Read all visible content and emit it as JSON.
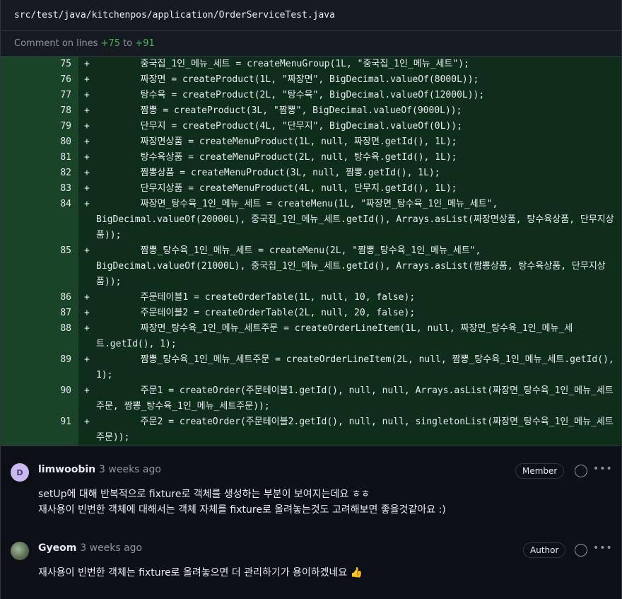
{
  "file": {
    "path": "src/test/java/kitchenpos/application/OrderServiceTest.java"
  },
  "comment_lines": {
    "prefix": "Comment on lines",
    "start": "+75",
    "sep": "to",
    "end": "+91"
  },
  "diff": [
    {
      "num": "75",
      "sign": "+",
      "text": "        중국집_1인_메뉴_세트 = createMenuGroup(1L, \"중국집_1인_메뉴_세트\");"
    },
    {
      "num": "76",
      "sign": "+",
      "text": "        짜장면 = createProduct(1L, \"짜장면\", BigDecimal.valueOf(8000L));"
    },
    {
      "num": "77",
      "sign": "+",
      "text": "        탕수육 = createProduct(2L, \"탕수육\", BigDecimal.valueOf(12000L));"
    },
    {
      "num": "78",
      "sign": "+",
      "text": "        짬뽕 = createProduct(3L, \"짬뽕\", BigDecimal.valueOf(9000L));"
    },
    {
      "num": "79",
      "sign": "+",
      "text": "        단무지 = createProduct(4L, \"단무지\", BigDecimal.valueOf(0L));"
    },
    {
      "num": "80",
      "sign": "+",
      "text": "        짜장면상품 = createMenuProduct(1L, null, 짜장면.getId(), 1L);"
    },
    {
      "num": "81",
      "sign": "+",
      "text": "        탕수육상품 = createMenuProduct(2L, null, 탕수육.getId(), 1L);"
    },
    {
      "num": "82",
      "sign": "+",
      "text": "        짬뽕상품 = createMenuProduct(3L, null, 짬뽕.getId(), 1L);"
    },
    {
      "num": "83",
      "sign": "+",
      "text": "        단무지상품 = createMenuProduct(4L, null, 단무지.getId(), 1L);"
    },
    {
      "num": "84",
      "sign": "+",
      "text": "        짜장면_탕수육_1인_메뉴_세트 = createMenu(1L, \"짜장면_탕수육_1인_메뉴_세트\",",
      "cont": "BigDecimal.valueOf(20000L), 중국집_1인_메뉴_세트.getId(), Arrays.asList(짜장면상품, 탕수육상품, 단무지상",
      "cont2": "품));"
    },
    {
      "num": "85",
      "sign": "+",
      "text": "        짬뽕_탕수육_1인_메뉴_세트 = createMenu(2L, \"짬뽕_탕수육_1인_메뉴_세트\",",
      "cont": "BigDecimal.valueOf(21000L), 중국집_1인_메뉴_세트.getId(), Arrays.asList(짬뽕상품, 탕수육상품, 단무지상",
      "cont2": "품));"
    },
    {
      "num": "86",
      "sign": "+",
      "text": "        주문테이블1 = createOrderTable(1L, null, 10, false);"
    },
    {
      "num": "87",
      "sign": "+",
      "text": "        주문테이블2 = createOrderTable(2L, null, 20, false);"
    },
    {
      "num": "88",
      "sign": "+",
      "text": "        짜장면_탕수육_1인_메뉴_세트주문 = createOrderLineItem(1L, null, 짜장면_탕수육_1인_메뉴_세",
      "cont": "트.getId(), 1);"
    },
    {
      "num": "89",
      "sign": "+",
      "text": "        짬뽕_탕수육_1인_메뉴_세트주문 = createOrderLineItem(2L, null, 짬뽕_탕수육_1인_메뉴_세트.getId(),",
      "cont": "1);"
    },
    {
      "num": "90",
      "sign": "+",
      "text": "        주문1 = createOrder(주문테이블1.getId(), null, null, Arrays.asList(짜장면_탕수육_1인_메뉴_세트",
      "cont": "주문, 짬뽕_탕수육_1인_메뉴_세트주문));"
    },
    {
      "num": "91",
      "sign": "+",
      "text": "        주문2 = createOrder(주문테이블2.getId(), null, null, singletonList(짜장면_탕수육_1인_메뉴_세트",
      "cont": "주문));"
    }
  ],
  "comments": [
    {
      "avatar_letter": "D",
      "author": "limwoobin",
      "time": "3 weeks ago",
      "badge": "Member",
      "body1": "setUp에 대해 반복적으로 fixture로 객체를 생성하는 부분이 보여지는데요 ㅎㅎ",
      "body2": "재사용이 빈번한 객체에 대해서는 객체 자체를 fixture로 올려놓는것도 고려해보면 좋을것같아요 :)"
    },
    {
      "avatar_letter": "",
      "author": "Gyeom",
      "time": "3 weeks ago",
      "badge": "Author",
      "body1": "재사용이 빈번한 객체는 fixture로 올려놓으면 더 관리하기가 용이하겠네요 👍"
    }
  ],
  "icons": {
    "emoji": "smiley-icon",
    "more": "kebab-horizontal-icon"
  },
  "colors": {
    "added_gutter": "#1a4428",
    "added_code": "#0f2d1b",
    "add_text": "#3fb950"
  }
}
